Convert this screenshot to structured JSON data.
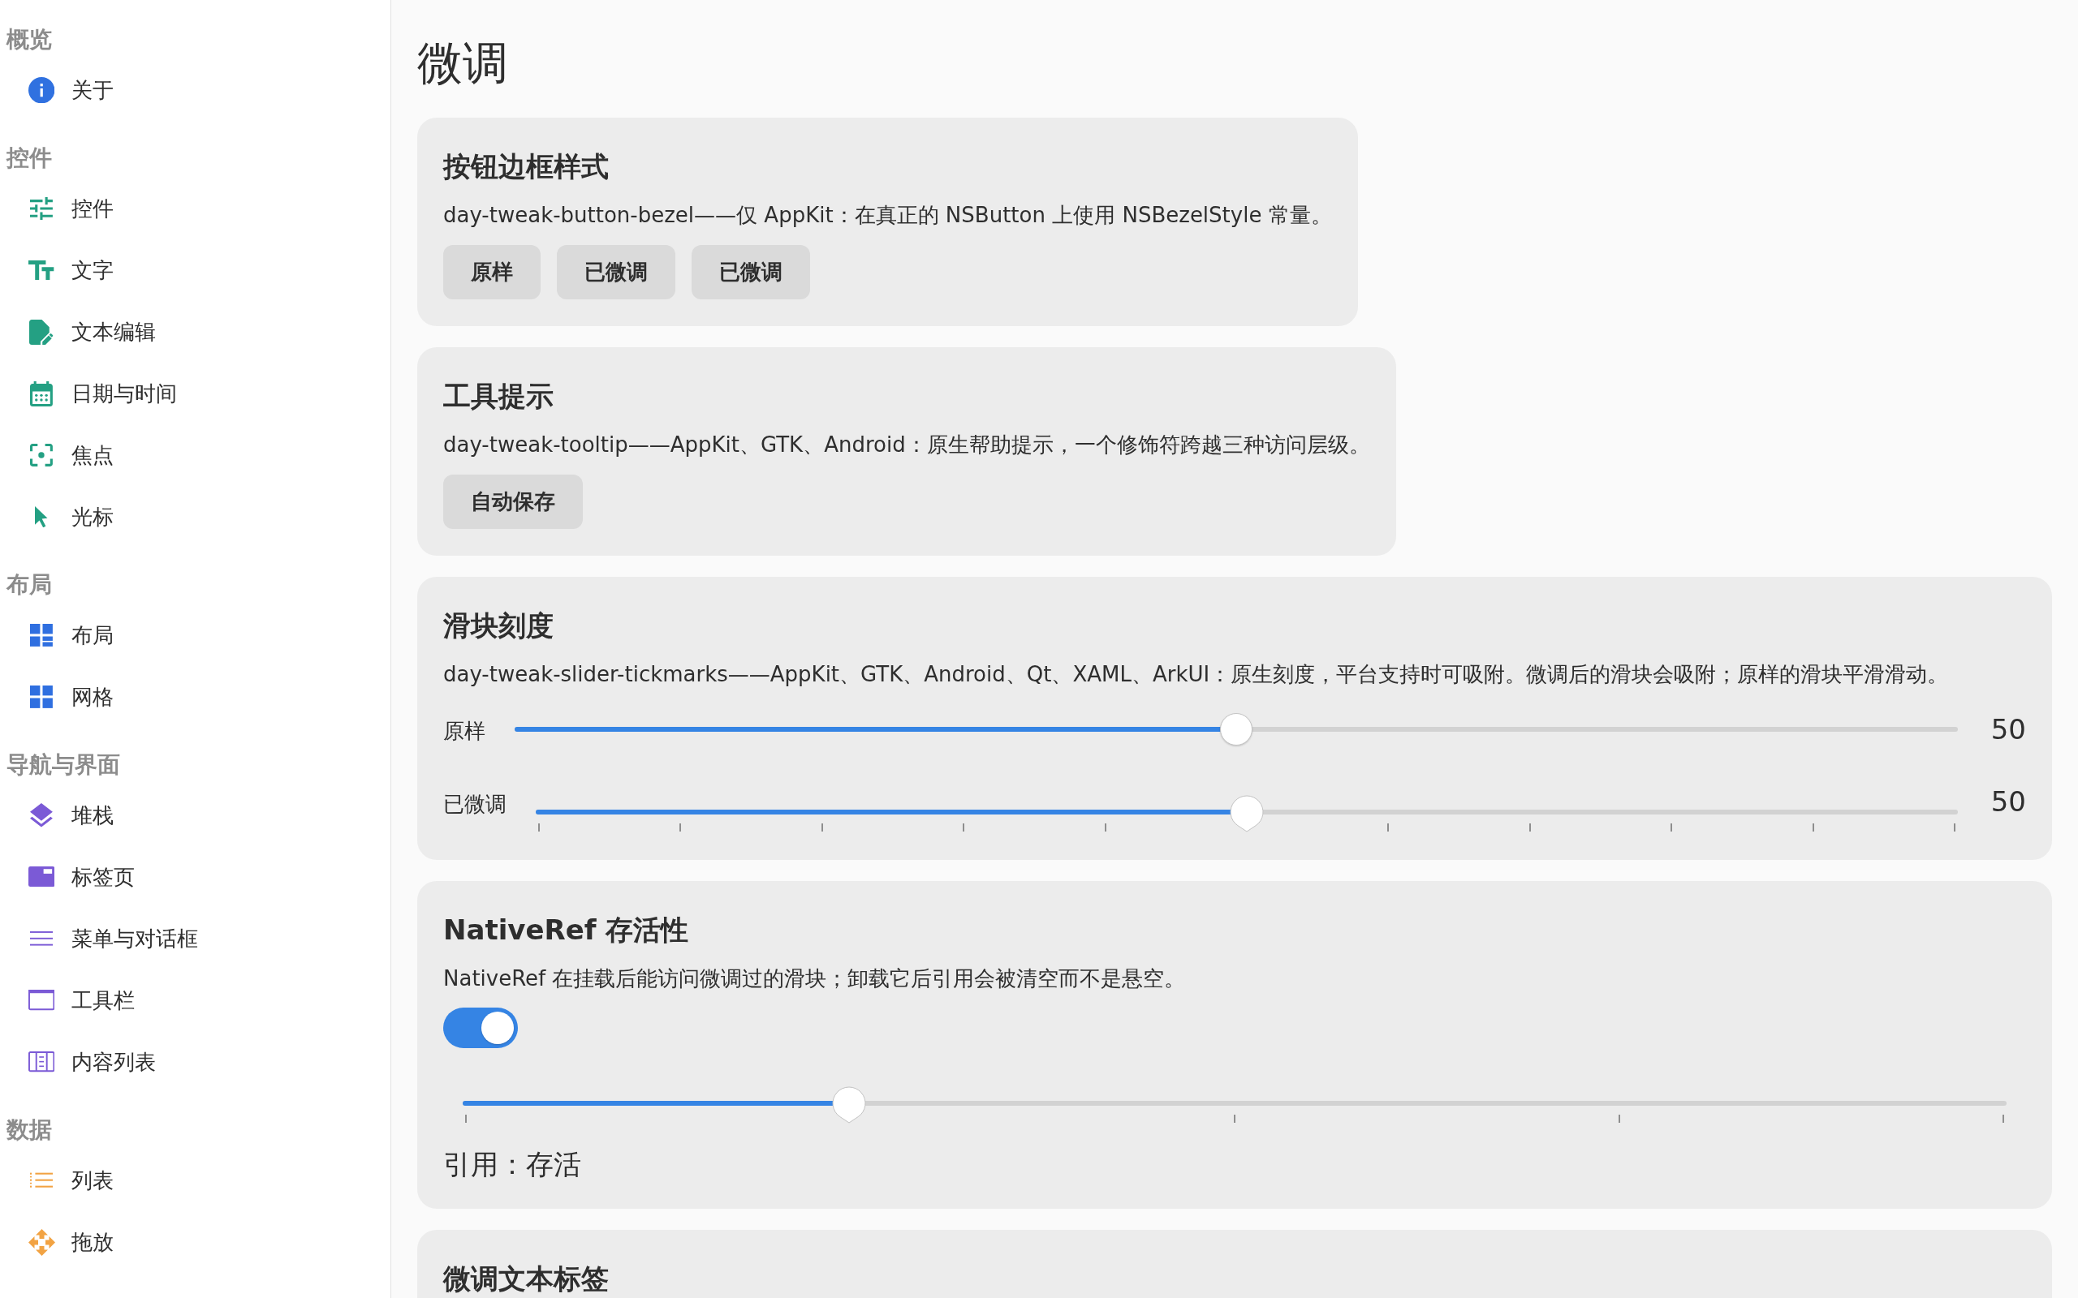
{
  "sidebar": {
    "sections": [
      {
        "title": "概览",
        "color": "#3071e0",
        "items": [
          {
            "label": "关于",
            "selected": false
          }
        ]
      },
      {
        "title": "控件",
        "color": "#24a083",
        "items": [
          {
            "label": "控件",
            "selected": false
          },
          {
            "label": "文字",
            "selected": false
          },
          {
            "label": "文本编辑",
            "selected": false
          },
          {
            "label": "日期与时间",
            "selected": false
          },
          {
            "label": "焦点",
            "selected": false
          },
          {
            "label": "光标",
            "selected": false
          }
        ]
      },
      {
        "title": "布局",
        "color": "#2f6fe0",
        "items": [
          {
            "label": "布局",
            "selected": false
          },
          {
            "label": "网格",
            "selected": false
          }
        ]
      },
      {
        "title": "导航与界面",
        "color": "#7b5ad6",
        "items": [
          {
            "label": "堆栈",
            "selected": false
          },
          {
            "label": "标签页",
            "selected": false
          },
          {
            "label": "菜单与对话框",
            "selected": false
          },
          {
            "label": "工具栏",
            "selected": false
          },
          {
            "label": "内容列表",
            "selected": false
          }
        ]
      },
      {
        "title": "数据",
        "color": "#f2a343",
        "items": [
          {
            "label": "列表",
            "selected": false
          },
          {
            "label": "拖放",
            "selected": false
          }
        ]
      }
    ]
  },
  "page": {
    "title": "微调"
  },
  "cards": [
    {
      "kind": "buttons",
      "title": "按钮边框样式",
      "description": "day-tweak-button-bezel——仅 AppKit：在真正的 NSButton 上使用 NSBezelStyle 常量。",
      "buttons": [
        "原样",
        "已微调",
        "已微调"
      ]
    },
    {
      "kind": "buttons",
      "title": "工具提示",
      "description": "day-tweak-tooltip——AppKit、GTK、Android：原生帮助提示，一个修饰符跨越三种访问层级。",
      "buttons": [
        "自动保存"
      ]
    },
    {
      "kind": "sliders",
      "title": "滑块刻度",
      "description": "day-tweak-slider-tickmarks——AppKit、GTK、Android、Qt、XAML、ArkUI：原生刻度，平台支持时可吸附。微调后的滑块会吸附；原样的滑块平滑滑动。",
      "sliders": [
        {
          "kind": "smooth",
          "label": "原样",
          "level": 0.5,
          "reading": "50"
        },
        {
          "kind": "tickmarks",
          "label": "已微调",
          "level": 0.5,
          "reading": "50"
        }
      ]
    },
    {
      "kind": "native_ref",
      "title": "NativeRef 存活性",
      "description": "NativeRef 在挂载后能访问微调过的滑块；卸载它后引用会被清空而不是悬空。",
      "toggle": {
        "on": true
      },
      "slider": {
        "kind": "quarter_marks",
        "level": 0.25
      },
      "status": "引用：存活"
    },
    {
      "kind": "plain",
      "title": "微调文本标签"
    }
  ]
}
